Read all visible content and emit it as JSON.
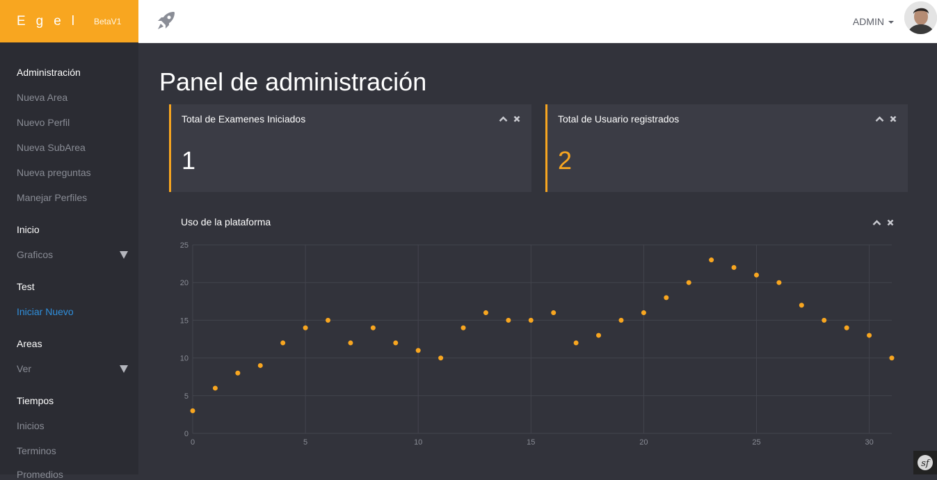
{
  "brand": {
    "name": "Egel",
    "version": "BetaV1"
  },
  "topbar": {
    "rocket_icon": "rocket-icon",
    "user_label": "ADMIN"
  },
  "sidebar": {
    "sections": [
      {
        "heading": "Administración",
        "items": [
          "Nueva Area",
          "Nuevo Perfil",
          "Nueva SubArea",
          "Nueva preguntas",
          "Manejar Perfiles"
        ]
      },
      {
        "heading": "Inicio",
        "items": [
          "Graficos"
        ]
      },
      {
        "heading": "Test",
        "items": [
          "Iniciar Nuevo"
        ]
      },
      {
        "heading": "Areas",
        "items": [
          "Ver"
        ]
      },
      {
        "heading": "Tiempos",
        "items": [
          "Inicios",
          "Terminos",
          "Promedios"
        ]
      }
    ]
  },
  "page": {
    "title": "Panel de administración"
  },
  "cards": [
    {
      "title": "Total de Examenes Iniciados",
      "value": "1",
      "value_color": "#ffffff"
    },
    {
      "title": "Total de Usuario registrados",
      "value": "2",
      "value_color": "#f8a620"
    }
  ],
  "chart_panel": {
    "title": "Uso de la plataforma"
  },
  "colors": {
    "accent": "#f8a620",
    "link_active": "#2f8fdc",
    "background": "#32333b"
  },
  "chart_data": {
    "type": "scatter",
    "title": "Uso de la plataforma",
    "x": [
      0,
      1,
      2,
      3,
      4,
      5,
      6,
      7,
      8,
      9,
      10,
      11,
      12,
      13,
      14,
      15,
      16,
      17,
      18,
      19,
      20,
      21,
      22,
      23,
      24,
      25,
      26,
      27,
      28,
      29,
      30,
      31
    ],
    "y": [
      3,
      6,
      8,
      9,
      12,
      14,
      15,
      12,
      14,
      12,
      11,
      10,
      14,
      16,
      15,
      15,
      16,
      12,
      13,
      15,
      16,
      18,
      20,
      23,
      22,
      21,
      20,
      17,
      15,
      14,
      13,
      10
    ],
    "x_ticks": [
      0,
      5,
      10,
      15,
      20,
      25,
      30
    ],
    "y_ticks": [
      0,
      5,
      10,
      15,
      20,
      25
    ],
    "xlim": [
      0,
      31
    ],
    "ylim": [
      0,
      25
    ],
    "grid": true,
    "point_color": "#f8a620"
  }
}
